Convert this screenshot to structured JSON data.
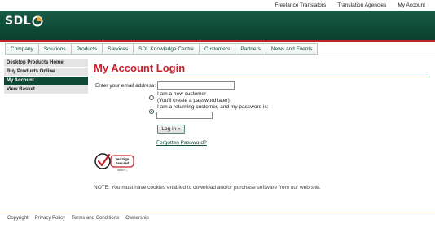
{
  "top_links": [
    "Freelance Translators",
    "Translation Agencies",
    "My Account"
  ],
  "logo": {
    "text": "SDL"
  },
  "nav": [
    "Company",
    "Solutions",
    "Products",
    "Services",
    "SDL Knowledge Centre",
    "Customers",
    "Partners",
    "News and Events"
  ],
  "sidebar": [
    {
      "label": "Desktop Products Home",
      "active": false
    },
    {
      "label": "Buy Products Online",
      "active": false
    },
    {
      "label": "My Account",
      "active": true
    },
    {
      "label": "View Basket",
      "active": false
    }
  ],
  "main": {
    "title": "My Account Login",
    "email_label": "Enter your email address:",
    "email_value": "",
    "new_customer_line1": "I am a new customer",
    "new_customer_line2": "(You'll create a password later)",
    "returning_customer": "I am a returning customer, and my password is:",
    "password_value": "",
    "login_button": "Log in »",
    "forgot_link": "Forgotten Password?",
    "note": "NOTE: You must have cookies enabled to download and/or purchase software from our web site."
  },
  "seal": {
    "line1": "VeriSign",
    "line2": "Secured",
    "line3": "VERIFY »"
  },
  "footer": [
    "Copyright",
    "Privacy Policy",
    "Terms and Conditions",
    "Ownership"
  ],
  "colors": {
    "brand_green": "#0e4a36",
    "accent_red": "#c8202b"
  }
}
